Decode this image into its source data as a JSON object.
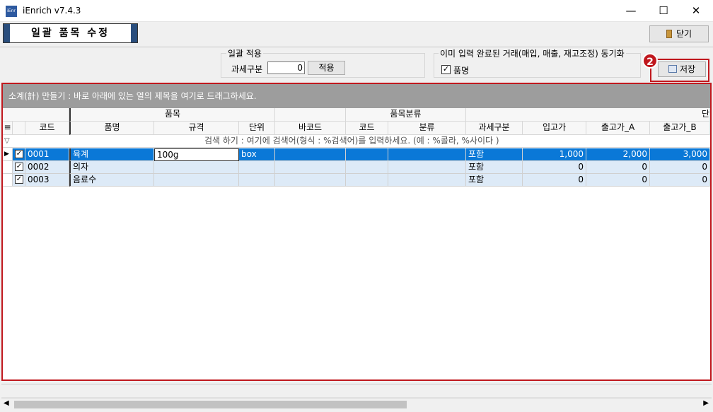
{
  "window": {
    "title": "iEnrich v7.4.3",
    "icon_text": "iEnr",
    "minimize": "—",
    "maximize": "☐",
    "close": "✕"
  },
  "header": {
    "page_title": "일괄 품목 수정",
    "close_label": "닫기"
  },
  "apply_group": {
    "title": "일괄 적용",
    "tax_label": "과세구분",
    "tax_value": "0",
    "apply_label": "적용"
  },
  "sync_group": {
    "title": "이미 입력 완료된 거래(매입, 매출, 재고조정) 동기화",
    "checkbox_label": "품명",
    "checked": true,
    "save_label": "저장"
  },
  "badge": "2",
  "accent_color": "#c0181e",
  "grid": {
    "group_panel": "소계(計) 만들기 : 바로 아래에 있는 열의 제목을 여기로 드래그하세요.",
    "band_headers": [
      "품목",
      "품목분류",
      "단"
    ],
    "columns": [
      "코드",
      "품명",
      "규격",
      "단위",
      "바코드",
      "코드",
      "분류",
      "과세구분",
      "입고가",
      "출고가_A",
      "출고가_B"
    ],
    "search_hint": "검색 하기 : 여기에 검색어(형식 : %검색어)를 입력하세요. (예 : %콜라, %사이다 )",
    "rows": [
      {
        "code": "0001",
        "name": "육계",
        "spec": "100g",
        "unit": "box",
        "barcode": "",
        "cat_code": "",
        "category": "",
        "tax": "포함",
        "in_price": "1,000",
        "out_a": "2,000",
        "out_b": "3,000",
        "selected": true
      },
      {
        "code": "0002",
        "name": "의자",
        "spec": "",
        "unit": "",
        "barcode": "",
        "cat_code": "",
        "category": "",
        "tax": "포함",
        "in_price": "0",
        "out_a": "0",
        "out_b": "0",
        "selected": false
      },
      {
        "code": "0003",
        "name": "음료수",
        "spec": "",
        "unit": "",
        "barcode": "",
        "cat_code": "",
        "category": "",
        "tax": "포함",
        "in_price": "0",
        "out_a": "0",
        "out_b": "0",
        "selected": false
      }
    ]
  }
}
